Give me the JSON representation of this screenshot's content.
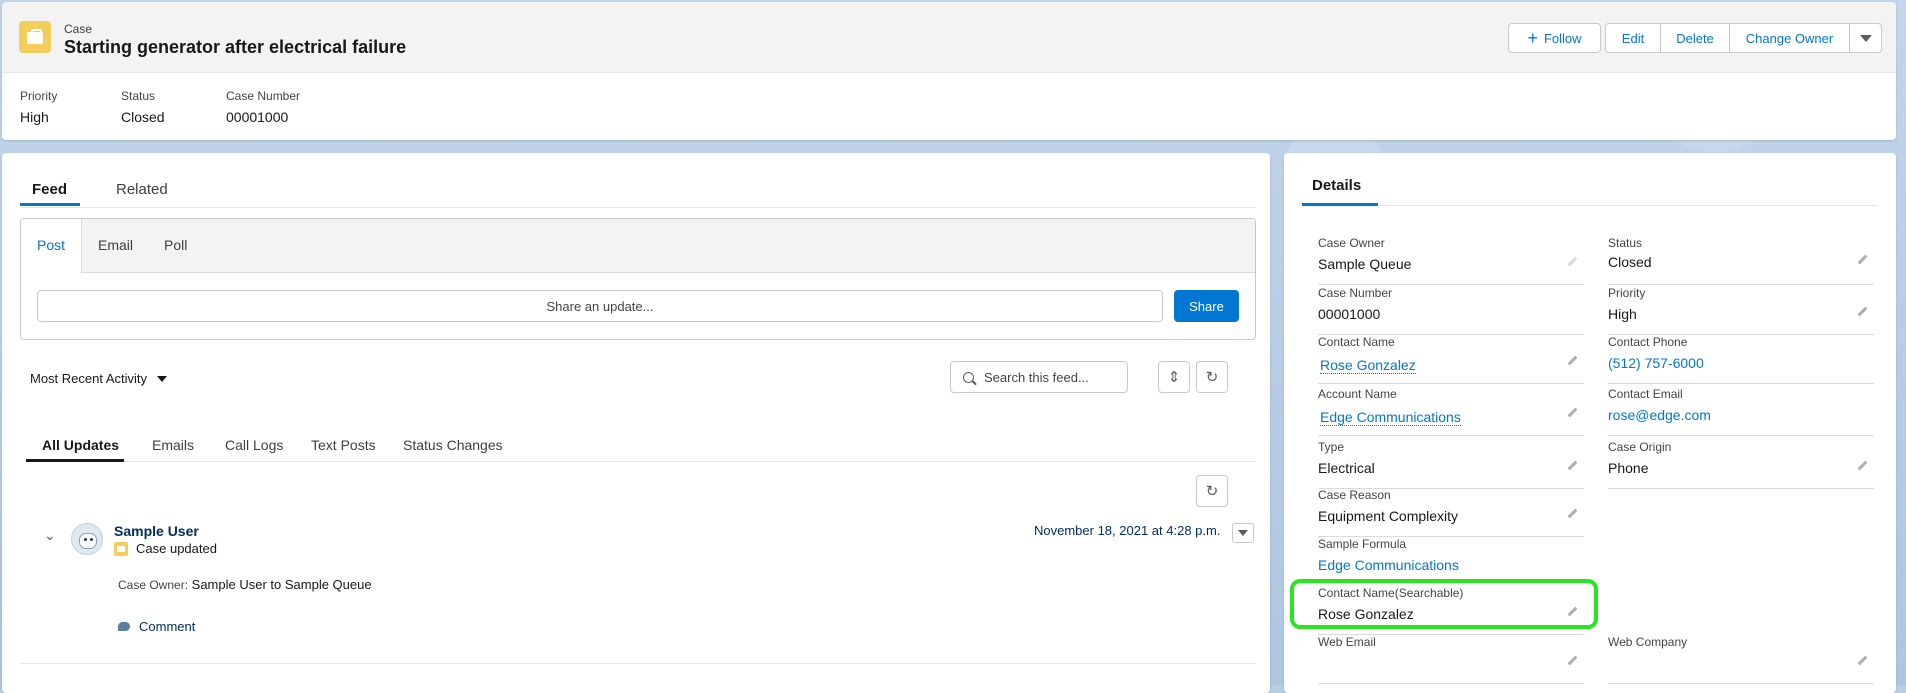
{
  "header": {
    "object_type": "Case",
    "title": "Starting generator after electrical failure",
    "buttons": {
      "follow": "Follow",
      "edit": "Edit",
      "delete": "Delete",
      "change_owner": "Change Owner"
    },
    "highlights": [
      {
        "label": "Priority",
        "value": "High"
      },
      {
        "label": "Status",
        "value": "Closed"
      },
      {
        "label": "Case Number",
        "value": "00001000"
      }
    ]
  },
  "feed_panel": {
    "tabs": [
      "Feed",
      "Related"
    ],
    "publisher_tabs": [
      "Post",
      "Email",
      "Poll"
    ],
    "share_placeholder": "Share an update...",
    "share_button": "Share",
    "sort_label": "Most Recent Activity",
    "search_placeholder": "Search this feed...",
    "filter_tabs": [
      "All Updates",
      "Emails",
      "Call Logs",
      "Text Posts",
      "Status Changes"
    ],
    "item": {
      "user": "Sample User",
      "action": "Case updated",
      "date": "November 18, 2021 at 4:28 p.m.",
      "change_label": "Case Owner:",
      "change_text": "Sample User to Sample Queue",
      "comment_label": "Comment"
    }
  },
  "details_panel": {
    "tab": "Details",
    "fields": [
      {
        "label": "Case Owner",
        "value": "Sample Queue"
      },
      {
        "label": "Status",
        "value": "Closed"
      },
      {
        "label": "Case Number",
        "value": "00001000"
      },
      {
        "label": "Priority",
        "value": "High"
      },
      {
        "label": "Contact Name",
        "value": "Rose Gonzalez"
      },
      {
        "label": "Contact Phone",
        "value": "(512) 757-6000"
      },
      {
        "label": "Account Name",
        "value": "Edge Communications"
      },
      {
        "label": "Contact Email",
        "value": "rose@edge.com"
      },
      {
        "label": "Type",
        "value": "Electrical"
      },
      {
        "label": "Case Origin",
        "value": "Phone"
      },
      {
        "label": "Case Reason",
        "value": "Equipment Complexity"
      },
      {
        "label": "Sample Formula",
        "value": "Edge Communications"
      },
      {
        "label": "Contact Name(Searchable)",
        "value": "Rose Gonzalez"
      },
      {
        "label": "Web Email",
        "value": ""
      },
      {
        "label": "Web Company",
        "value": ""
      }
    ]
  },
  "colors": {
    "brand_blue": "#0176d3",
    "highlight_green": "#27e51f",
    "case_icon_yellow": "#f2cf5b"
  }
}
